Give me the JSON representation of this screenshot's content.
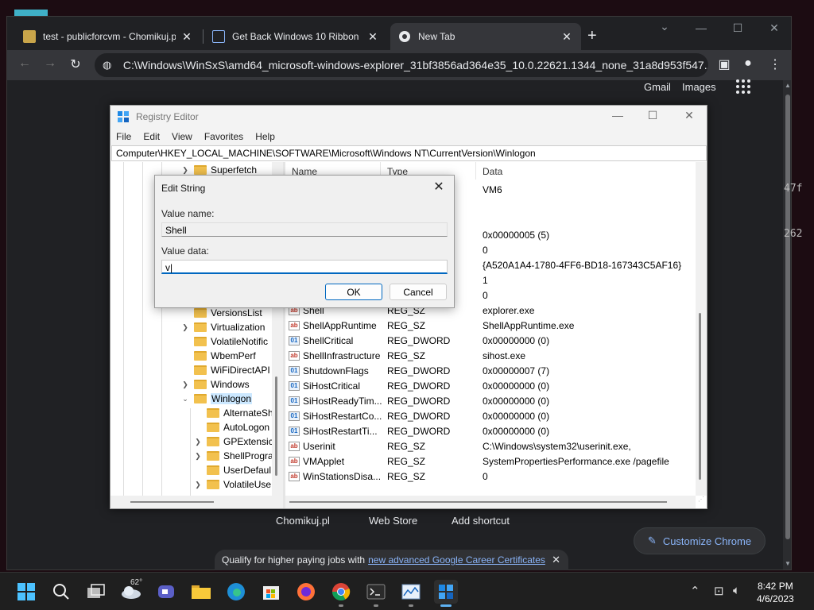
{
  "browser": {
    "tabs": [
      {
        "title": "test - publicforcvm - Chomikuj.pl"
      },
      {
        "title": "Get Back Windows 10 Ribbon UI"
      },
      {
        "title": "New Tab"
      }
    ],
    "address": "C:\\Windows\\WinSxS\\amd64_microsoft-windows-explorer_31bf3856ad364e35_10.0.22621.1344_none_31a8d953f547...",
    "gmail": "Gmail",
    "images": "Images",
    "shortcuts": [
      "Chomikuj.pl",
      "Web Store",
      "Add shortcut"
    ],
    "customize_label": "Customize Chrome",
    "promo_text": "Qualify for higher paying jobs with",
    "promo_link": "new advanced Google Career Certificates",
    "side_text_1": "47f",
    "side_text_2": "262"
  },
  "regedit": {
    "title": "Registry Editor",
    "menu": [
      "File",
      "Edit",
      "View",
      "Favorites",
      "Help"
    ],
    "address": "Computer\\HKEY_LOCAL_MACHINE\\SOFTWARE\\Microsoft\\Windows NT\\CurrentVersion\\Winlogon",
    "tree": [
      {
        "label": "Superfetch"
      },
      {
        "label": "VersionsList"
      },
      {
        "label": "Virtualization"
      },
      {
        "label": "VolatileNotific"
      },
      {
        "label": "WbemPerf"
      },
      {
        "label": "WiFiDirectAPI"
      },
      {
        "label": "Windows"
      },
      {
        "label": "Winlogon"
      },
      {
        "label": "AlternateSh"
      },
      {
        "label": "AutoLogon"
      },
      {
        "label": "GPExtensic"
      },
      {
        "label": "ShellProgra"
      },
      {
        "label": "UserDefaul"
      },
      {
        "label": "VolatileUse"
      }
    ],
    "columns": [
      "Name",
      "Type",
      "Data"
    ],
    "rows_partial_data": [
      "VM6",
      "0x00000005 (5)",
      "0",
      "{A520A1A4-1780-4FF6-BD18-167343C5AF16}",
      "1",
      "0"
    ],
    "rows": [
      {
        "name": "Shell",
        "type": "REG_SZ",
        "data": "explorer.exe"
      },
      {
        "name": "ShellAppRuntime",
        "type": "REG_SZ",
        "data": "ShellAppRuntime.exe"
      },
      {
        "name": "ShellCritical",
        "type": "REG_DWORD",
        "data": "0x00000000 (0)"
      },
      {
        "name": "ShellInfrastructure",
        "type": "REG_SZ",
        "data": "sihost.exe"
      },
      {
        "name": "ShutdownFlags",
        "type": "REG_DWORD",
        "data": "0x00000007 (7)"
      },
      {
        "name": "SiHostCritical",
        "type": "REG_DWORD",
        "data": "0x00000000 (0)"
      },
      {
        "name": "SiHostReadyTim...",
        "type": "REG_DWORD",
        "data": "0x00000000 (0)"
      },
      {
        "name": "SiHostRestartCo...",
        "type": "REG_DWORD",
        "data": "0x00000000 (0)"
      },
      {
        "name": "SiHostRestartTi...",
        "type": "REG_DWORD",
        "data": "0x00000000 (0)"
      },
      {
        "name": "Userinit",
        "type": "REG_SZ",
        "data": "C:\\Windows\\system32\\userinit.exe,"
      },
      {
        "name": "VMApplet",
        "type": "REG_SZ",
        "data": "SystemPropertiesPerformance.exe /pagefile"
      },
      {
        "name": "WinStationsDisa...",
        "type": "REG_SZ",
        "data": "0"
      }
    ]
  },
  "dialog": {
    "title": "Edit String",
    "value_name_label": "Value name:",
    "value_name": "Shell",
    "value_data_label": "Value data:",
    "value_data": "v|",
    "ok": "OK",
    "cancel": "Cancel"
  },
  "taskbar": {
    "temperature": "62°",
    "time": "8:42 PM",
    "date": "4/6/2023"
  }
}
